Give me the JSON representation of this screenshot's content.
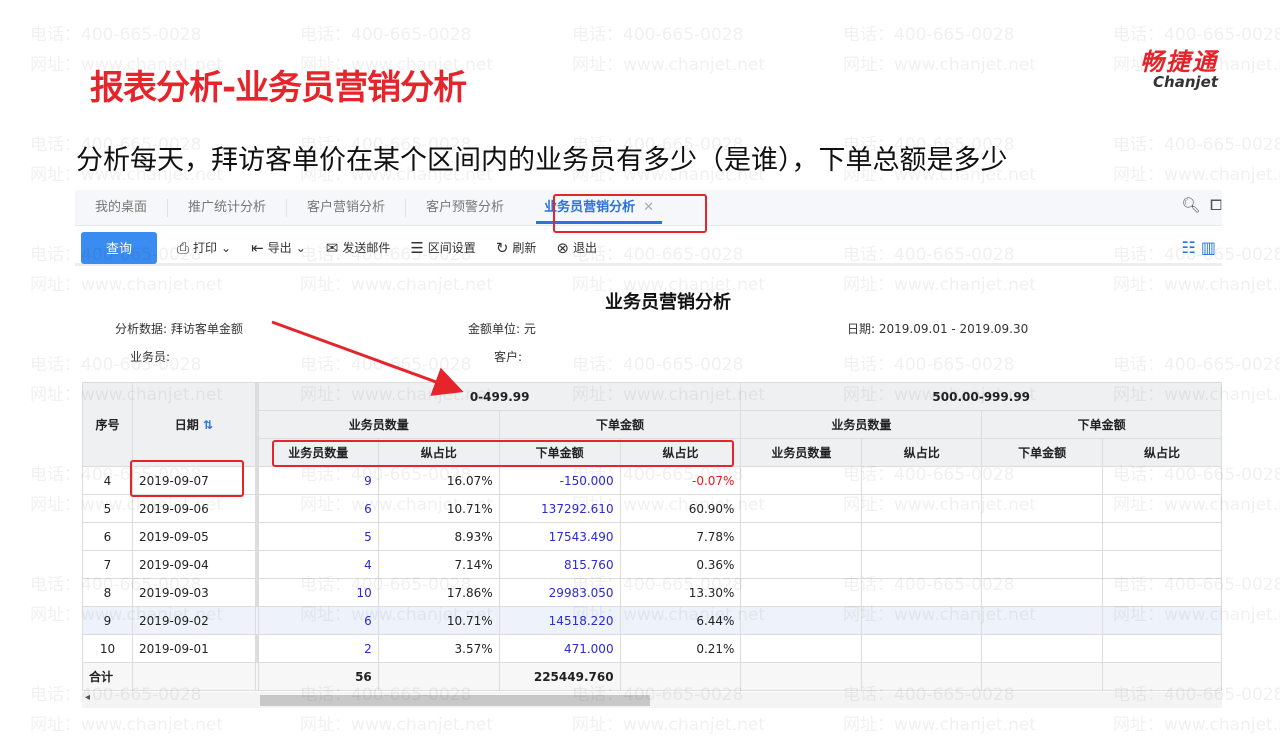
{
  "slide": {
    "title": "报表分析-业务员营销分析",
    "subtitle": "分析每天，拜访客单价在某个区间内的业务员有多少（是谁），下单总额是多少",
    "logo_cn": "畅捷通",
    "logo_en": "Chanjet",
    "watermark_phone": "电话：400-665-0028",
    "watermark_site": "网址：www.chanjet.net"
  },
  "tabs": [
    {
      "label": "我的桌面"
    },
    {
      "label": "推广统计分析"
    },
    {
      "label": "客户营销分析"
    },
    {
      "label": "客户预警分析"
    },
    {
      "label": "业务员营销分析",
      "active": true
    }
  ],
  "toolbar": {
    "query": "查询",
    "print": "打印",
    "export": "导出",
    "email": "发送邮件",
    "range": "区间设置",
    "refresh": "刷新",
    "exit": "退出"
  },
  "report": {
    "title": "业务员营销分析",
    "analysis_label": "分析数据:",
    "analysis_value": "拜访客单金额",
    "unit_label": "金额单位:",
    "unit_value": "元",
    "date_label": "日期:",
    "date_value": "2019.09.01 - 2019.09.30",
    "salesman_label": "业务员:",
    "customer_label": "客户:"
  },
  "table": {
    "col_no": "序号",
    "col_date": "日期",
    "ranges": [
      "0-499.99",
      "500.00-999.99"
    ],
    "groups": [
      "业务员数量",
      "下单金额"
    ],
    "subcols": [
      "业务员数量",
      "纵占比",
      "下单金额",
      "纵占比"
    ],
    "rows": [
      {
        "no": "4",
        "date": "2019-09-07",
        "count": "9",
        "pct": "16.07%",
        "amount": "-150.000",
        "apct": "-0.07%"
      },
      {
        "no": "5",
        "date": "2019-09-06",
        "count": "6",
        "pct": "10.71%",
        "amount": "137292.610",
        "apct": "60.90%"
      },
      {
        "no": "6",
        "date": "2019-09-05",
        "count": "5",
        "pct": "8.93%",
        "amount": "17543.490",
        "apct": "7.78%"
      },
      {
        "no": "7",
        "date": "2019-09-04",
        "count": "4",
        "pct": "7.14%",
        "amount": "815.760",
        "apct": "0.36%"
      },
      {
        "no": "8",
        "date": "2019-09-03",
        "count": "10",
        "pct": "17.86%",
        "amount": "29983.050",
        "apct": "13.30%"
      },
      {
        "no": "9",
        "date": "2019-09-02",
        "count": "6",
        "pct": "10.71%",
        "amount": "14518.220",
        "apct": "6.44%"
      },
      {
        "no": "10",
        "date": "2019-09-01",
        "count": "2",
        "pct": "3.57%",
        "amount": "471.000",
        "apct": "0.21%"
      }
    ],
    "total_label": "合计",
    "total_count": "56",
    "total_amount": "225449.760"
  },
  "colors": {
    "accent": "#e5242b",
    "primary": "#3b8cf0",
    "link": "#2b2bd0"
  }
}
